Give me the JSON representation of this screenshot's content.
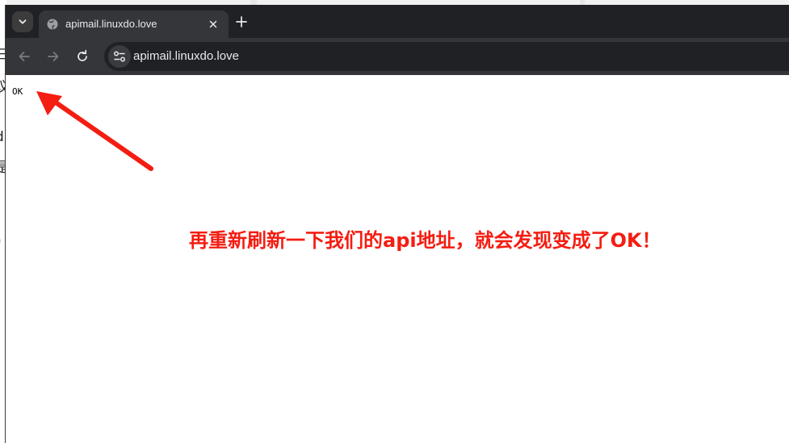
{
  "background": {
    "fragments": [
      "三",
      "议",
      "d",
      "是",
      "\""
    ]
  },
  "browser": {
    "tab": {
      "title": "apimail.linuxdo.love",
      "favicon": "globe-icon",
      "close_icon": "close-icon"
    },
    "tab_search_icon": "chevron-down-icon",
    "new_tab_icon": "plus-icon",
    "toolbar": {
      "back_icon": "arrow-left-icon",
      "forward_icon": "arrow-right-icon",
      "reload_icon": "reload-icon",
      "site_info_icon": "tune-icon",
      "url": "apimail.linuxdo.love"
    },
    "theme": {
      "tabstrip_bg": "#202124",
      "toolbar_bg": "#35363a",
      "text": "#e8eaed"
    }
  },
  "page": {
    "body_text": "OK"
  },
  "annotation": {
    "text": "再重新刷新一下我们的api地址，就会发现变成了OK！",
    "color": "#f41d12",
    "arrow_icon": "red-arrow-icon"
  }
}
